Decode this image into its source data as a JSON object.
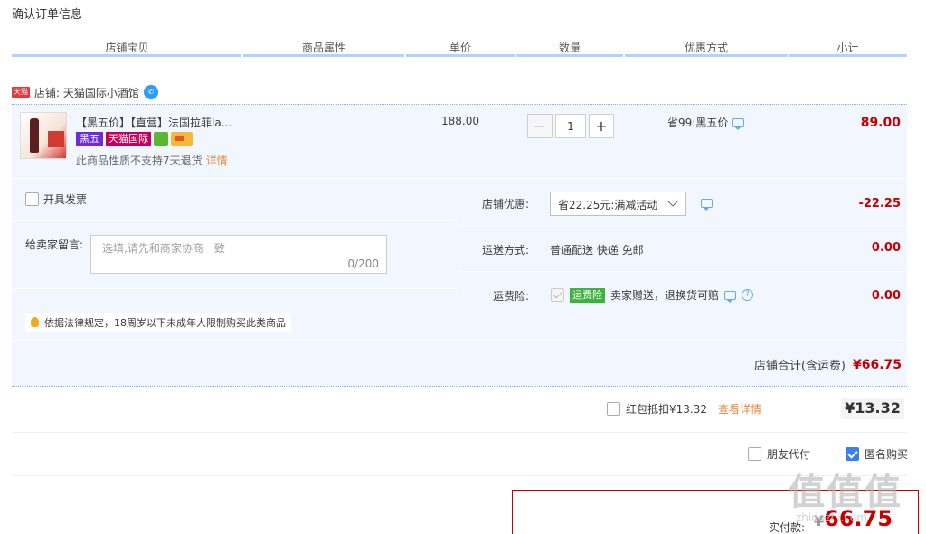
{
  "page": {
    "title": "确认订单信息"
  },
  "columns": [
    "店铺宝贝",
    "商品属性",
    "单价",
    "数量",
    "优惠方式",
    "小计"
  ],
  "shop": {
    "badge": "天猫",
    "label": "店铺: 天猫国际小酒馆"
  },
  "item": {
    "title": "【黑五价】【直营】法国拉菲la...",
    "badge_black": "黑五",
    "badge_intl": "天猫国际",
    "no_return": "此商品性质不支持7天退货",
    "details_link": "详情",
    "unit_price": "188.00",
    "quantity": "1",
    "discount": "省99:黑五价",
    "subtotal": "89.00"
  },
  "options": {
    "invoice_label": "开具发票",
    "message_label": "给卖家留言:",
    "message_placeholder": "选填,请先和商家协商一致",
    "message_count": "0/200",
    "law_notice": "依据法律规定，18周岁以下未成年人限制购买此类商品",
    "shop_discount_label": "店铺优惠:",
    "shop_discount_value": "省22.25元:满减活动",
    "shop_discount_amount": "-22.25",
    "shipping_label": "运送方式:",
    "shipping_value": "普通配送 快递 免邮",
    "shipping_amount": "0.00",
    "insurance_label": "运费险:",
    "insurance_badge": "运费险",
    "insurance_text": "卖家赠送，退换货可赔",
    "insurance_amount": "0.00"
  },
  "shop_total": {
    "label": "店铺合计(含运费)",
    "amount": "¥66.75"
  },
  "redpacket": {
    "label": "红包抵扣¥13.32",
    "link": "查看详情",
    "amount": "¥13.32"
  },
  "friend_pay": "朋友代付",
  "anonymous": "匿名购买",
  "payment": {
    "label": "实付款:",
    "currency": "¥",
    "amount": "66.75"
  },
  "watermark": {
    "main": "值值值",
    "sub": "zhidezhi.com"
  },
  "colors": {
    "accent": "#c40000",
    "header_line": "#b2d1ff",
    "row_bg": "#f2f7ff"
  }
}
